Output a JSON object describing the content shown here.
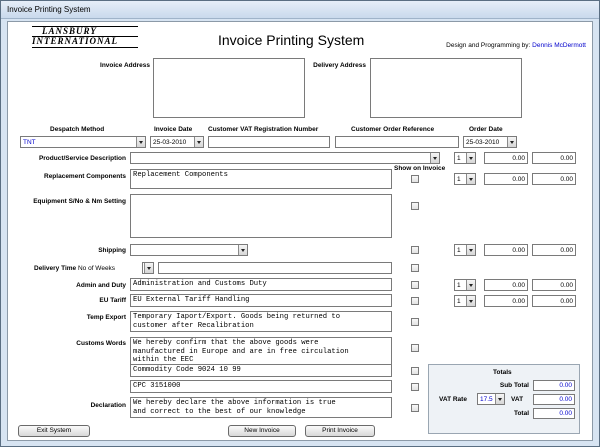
{
  "window": {
    "title": "Invoice Printing System"
  },
  "logo": {
    "line1": "LANSBURY",
    "line2": "INTERNATIONAL"
  },
  "header": {
    "title": "Invoice Printing System",
    "credit_label": "Design and Programming by:",
    "credit_name": "Dennis McDermott"
  },
  "address": {
    "invoice_label": "Invoice Address",
    "delivery_label": "Delivery Address"
  },
  "order": {
    "despatch_label": "Despatch Method",
    "despatch_value": "TNT",
    "invoice_date_label": "Invoice Date",
    "invoice_date_value": "25-03-2010",
    "vat_reg_label": "Customer VAT Registration Number",
    "order_ref_label": "Customer Order Reference",
    "order_date_label": "Order Date",
    "order_date_value": "25-03-2010"
  },
  "show_on_invoice": "Show on Invoice",
  "rows": {
    "product": {
      "label": "Product/Service Description",
      "qty": "1",
      "unit": "0.00",
      "total": "0.00"
    },
    "replacement": {
      "label": "Replacement Components",
      "text": "Replacement Components",
      "qty": "1",
      "unit": "0.00",
      "total": "0.00"
    },
    "equipment": {
      "label": "Equipment S/No & Nm Setting"
    },
    "shipping": {
      "label": "Shipping",
      "qty": "1",
      "unit": "0.00",
      "total": "0.00"
    },
    "delivery": {
      "label": "Delivery Time",
      "weeks_label": "No of Weeks"
    },
    "admin": {
      "label": "Admin and  Duty",
      "text": "Administration and Customs Duty",
      "qty": "1",
      "unit": "0.00",
      "total": "0.00"
    },
    "tariff": {
      "label": "EU Tariff",
      "text": "EU External Tariff Handling",
      "qty": "1",
      "unit": "0.00",
      "total": "0.00"
    },
    "temp_export": {
      "label": "Temp Export",
      "text": "Temporary Iaport/Export. Goods being returned to\ncustomer after Recalibration"
    },
    "customs": {
      "label": "Customs Words",
      "text": "We hereby confirm that the above goods were\nmanufactured in Europe and are in free circulation\nwithin the EEC",
      "commodity": "Commodity Code 9024 10 99",
      "cpc": "CPC 3151000"
    },
    "declaration": {
      "label": "Declaration",
      "text": "We hereby declare the above information is true\nand correct to the best of our knowledge"
    }
  },
  "totals": {
    "heading": "Totals",
    "subtotal_label": "Sub Total",
    "subtotal_value": "0.00",
    "vat_rate_label": "VAT Rate",
    "vat_rate_value": "17.5",
    "vat_label": "VAT",
    "vat_value": "0.00",
    "total_label": "Total",
    "total_value": "0.00"
  },
  "buttons": {
    "exit": "Exit System",
    "new_invoice": "New Invoice",
    "print_invoice": "Print Invoice"
  }
}
